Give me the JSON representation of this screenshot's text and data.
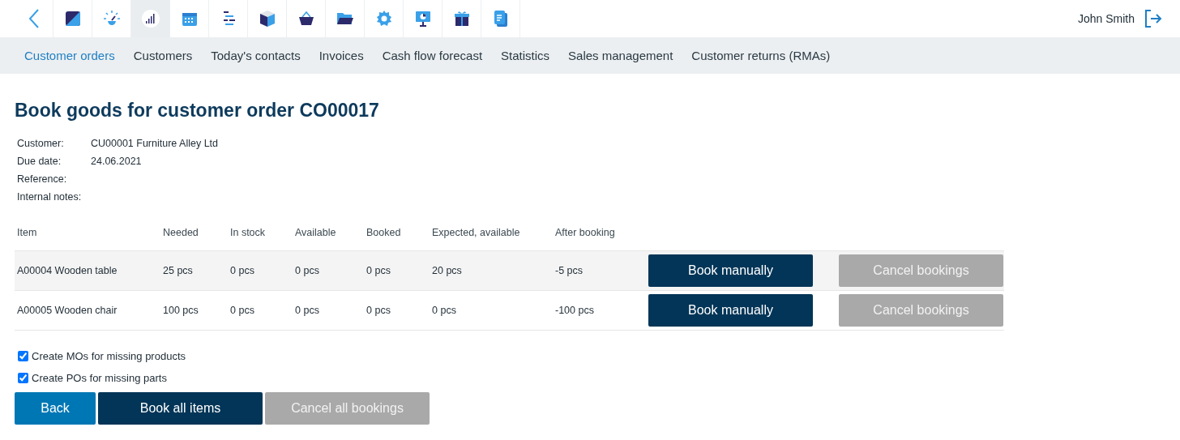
{
  "toolbar": {
    "app_icons": [
      {
        "selected": false
      },
      {
        "selected": false
      },
      {
        "selected": true
      },
      {
        "selected": false
      },
      {
        "selected": false
      },
      {
        "selected": false
      },
      {
        "selected": false
      },
      {
        "selected": false
      },
      {
        "selected": false
      },
      {
        "selected": false
      },
      {
        "selected": false
      },
      {
        "selected": false
      }
    ],
    "user_name": "John Smith"
  },
  "nav_tabs": [
    {
      "label": "Customer orders",
      "selected": true
    },
    {
      "label": "Customers",
      "selected": false
    },
    {
      "label": "Today's contacts",
      "selected": false
    },
    {
      "label": "Invoices",
      "selected": false
    },
    {
      "label": "Cash flow forecast",
      "selected": false
    },
    {
      "label": "Statistics",
      "selected": false
    },
    {
      "label": "Sales management",
      "selected": false
    },
    {
      "label": "Customer returns (RMAs)",
      "selected": false
    }
  ],
  "title": "Book goods for customer order CO00017",
  "details": [
    {
      "label": "Customer:",
      "value": "CU00001 Furniture Alley Ltd"
    },
    {
      "label": "Due date:",
      "value": "24.06.2021"
    },
    {
      "label": "Reference:"
    },
    {
      "label": "Internal notes:"
    }
  ],
  "table": {
    "columns": [
      "Item",
      "Needed",
      "In stock",
      "Available",
      "Booked",
      "Expected, available",
      "After booking"
    ],
    "rows": [
      {
        "cells": [
          "A00004 Wooden table",
          "25 pcs",
          "0 pcs",
          "0 pcs",
          "0 pcs",
          "20 pcs",
          "-5 pcs"
        ],
        "buttons": [
          {
            "label": "Book manually",
            "disabled": false
          },
          {
            "label": "Cancel bookings",
            "disabled": true
          }
        ]
      },
      {
        "cells": [
          "A00005 Wooden chair",
          "100 pcs",
          "0 pcs",
          "0 pcs",
          "0 pcs",
          "0 pcs",
          "-100 pcs"
        ],
        "buttons": [
          {
            "label": "Book manually",
            "disabled": false
          },
          {
            "label": "Cancel bookings",
            "disabled": true
          }
        ]
      }
    ]
  },
  "options": [
    {
      "label": "Create MOs for missing products",
      "checked": true
    },
    {
      "label": "Create POs for missing parts",
      "checked": true
    }
  ],
  "actions": [
    {
      "label": "Back",
      "kind": "back",
      "disabled": false
    },
    {
      "label": "Book all items",
      "kind": "primary",
      "disabled": false
    },
    {
      "label": "Cancel all bookings",
      "kind": "primary",
      "disabled": true
    }
  ]
}
